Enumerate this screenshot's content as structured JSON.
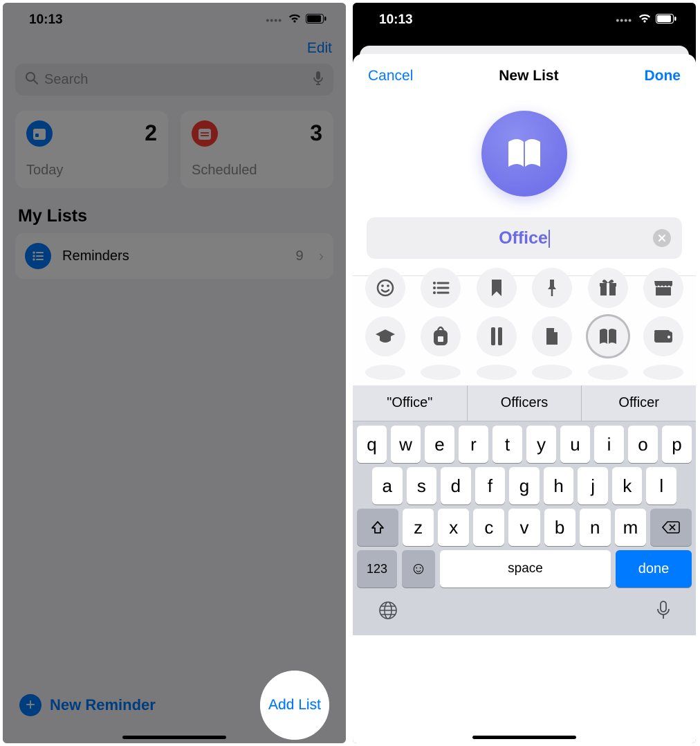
{
  "left": {
    "status": {
      "time": "10:13"
    },
    "nav": {
      "edit": "Edit"
    },
    "search": {
      "placeholder": "Search"
    },
    "cards": [
      {
        "label": "Today",
        "count": "2"
      },
      {
        "label": "Scheduled",
        "count": "3"
      }
    ],
    "mylists_header": "My Lists",
    "lists": [
      {
        "name": "Reminders",
        "count": "9"
      }
    ],
    "footer": {
      "new_reminder": "New Reminder",
      "add_list": "Add List"
    }
  },
  "right": {
    "status": {
      "time": "10:13"
    },
    "sheet": {
      "cancel": "Cancel",
      "title": "New List",
      "done": "Done",
      "name_value": "Office",
      "icon_color": "#6a6ae8",
      "selected_glyph": "book-icon"
    },
    "glyph_rows": [
      [
        "smiley-icon",
        "list-icon",
        "bookmark-icon",
        "pin-icon",
        "gift-icon",
        "store-icon"
      ],
      [
        "graduation-icon",
        "backpack-icon",
        "ruler-icon",
        "document-icon",
        "book-icon",
        "wallet-icon"
      ],
      [
        "id-icon",
        "card-icon",
        "utensils-icon",
        "running-icon",
        "fork-icon",
        "wine-icon"
      ]
    ],
    "keyboard": {
      "suggestions": [
        "\"Office\"",
        "Officers",
        "Officer"
      ],
      "row1": [
        "q",
        "w",
        "e",
        "r",
        "t",
        "y",
        "u",
        "i",
        "o",
        "p"
      ],
      "row2": [
        "a",
        "s",
        "d",
        "f",
        "g",
        "h",
        "j",
        "k",
        "l"
      ],
      "row3": [
        "z",
        "x",
        "c",
        "v",
        "b",
        "n",
        "m"
      ],
      "num_key": "123",
      "space": "space",
      "done": "done"
    }
  }
}
